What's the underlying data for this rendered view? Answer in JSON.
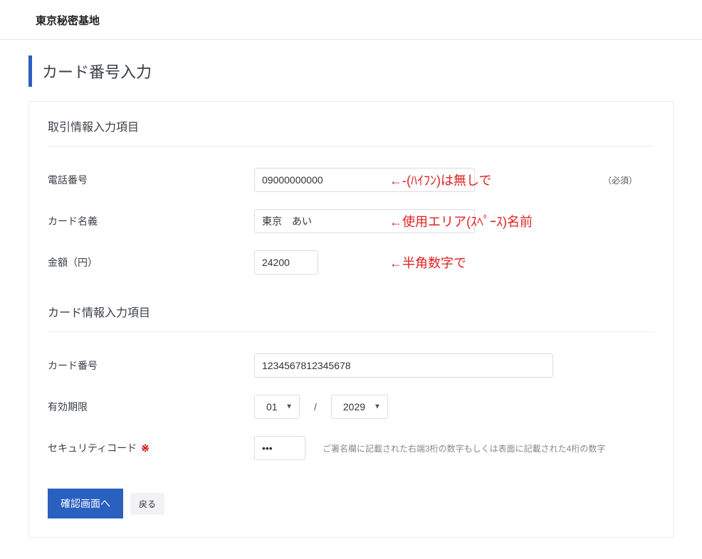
{
  "header": {
    "site_title": "東京秘密基地"
  },
  "page": {
    "heading": "カード番号入力"
  },
  "transaction_section": {
    "title": "取引情報入力項目",
    "phone": {
      "label": "電話番号",
      "value": "09000000000",
      "annotation": "←-(ﾊｲﾌﾝ)は無しで",
      "required_tag": "（必須）"
    },
    "cardname": {
      "label": "カード名義",
      "value": "東京　あい",
      "annotation": "←使用エリア(ｽﾍﾟｰｽ)名前"
    },
    "amount": {
      "label": "金額（円）",
      "value": "24200",
      "annotation": "←半角数字で"
    }
  },
  "card_section": {
    "title": "カード情報入力項目",
    "cardnumber": {
      "label": "カード番号",
      "value": "1234567812345678"
    },
    "expiry": {
      "label": "有効期限",
      "month": "01",
      "year": "2029"
    },
    "cvc": {
      "label": "セキュリティコード",
      "required_mark": "※",
      "value": "•••",
      "hint": "ご署名欄に記載された右端3桁の数字もしくは表面に記載された4桁の数字"
    }
  },
  "actions": {
    "confirm": "確認画面へ",
    "back": "戻る"
  }
}
